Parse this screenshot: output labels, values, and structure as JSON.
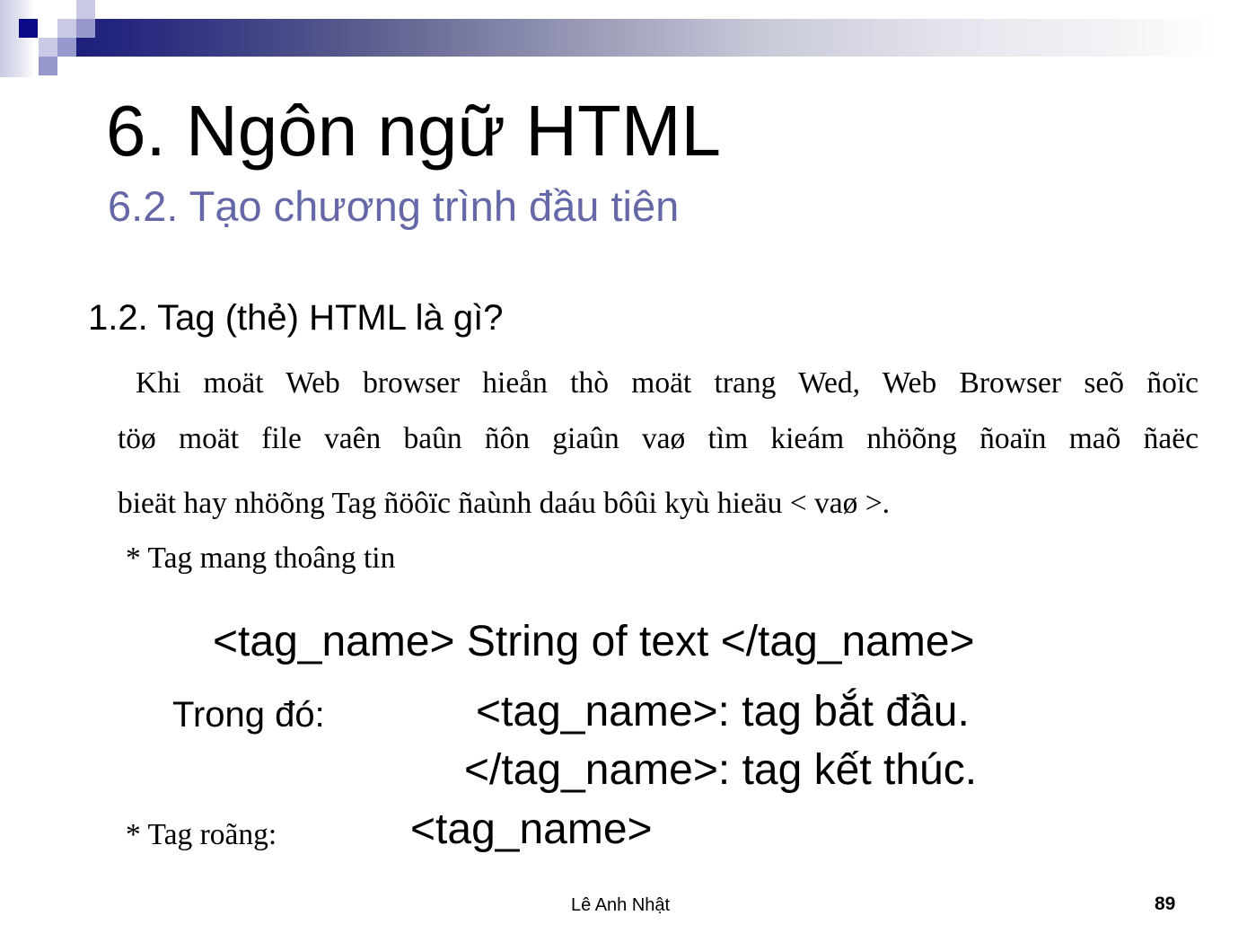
{
  "slide": {
    "title": "6. Ngôn ngữ HTML",
    "subtitle": "6.2. Tạo chương trình đầu tiên",
    "accent_color": "#6468a6",
    "banner_color": "#1c1f7c"
  },
  "content": {
    "section_heading": "1.2. Tag (thẻ) HTML là gì?",
    "paragraph_lines": [
      "Khi moät Web browser hieån thò moät trang Wed, Web Browser seõ ñoïc",
      "töø moät file vaên baûn ñôn giaûn vaø tìm kieám nhöõng ñoaïn maõ ñaëc",
      "bieät hay nhöõng Tag ñöôïc ñaùnh daáu bôûi kyù hieäu < vaø >."
    ],
    "bullet_info": "* Tag mang thoâng tin",
    "syntax": "<tag_name> String of text </tag_name>",
    "where_label": "Trong đó:",
    "def_open": "<tag_name>: tag bắt đầu.",
    "def_close": "</tag_name>: tag kết thúc.",
    "bullet_empty": "* Tag roãng:",
    "empty_tag": "<tag_name>"
  },
  "footer": {
    "author": "Lê Anh Nhật",
    "page_number": "89"
  }
}
